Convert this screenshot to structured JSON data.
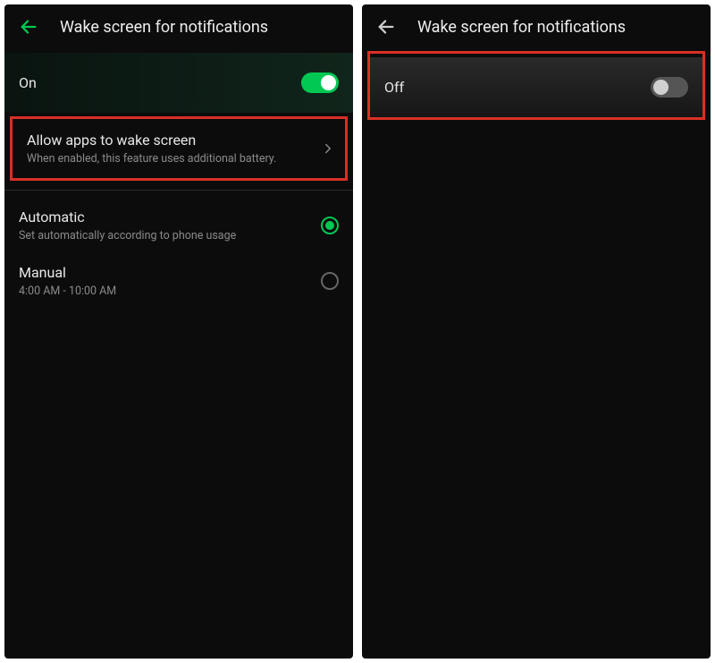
{
  "left": {
    "header": {
      "title": "Wake screen for notifications"
    },
    "main_toggle": {
      "label": "On",
      "state": "on"
    },
    "allow_apps": {
      "title": "Allow apps to wake screen",
      "subtitle": "When enabled, this feature uses additional battery."
    },
    "options": [
      {
        "title": "Automatic",
        "subtitle": "Set automatically according to phone usage",
        "selected": true
      },
      {
        "title": "Manual",
        "subtitle": "4:00 AM - 10:00 AM",
        "selected": false
      }
    ]
  },
  "right": {
    "header": {
      "title": "Wake screen for notifications"
    },
    "main_toggle": {
      "label": "Off",
      "state": "off"
    }
  }
}
